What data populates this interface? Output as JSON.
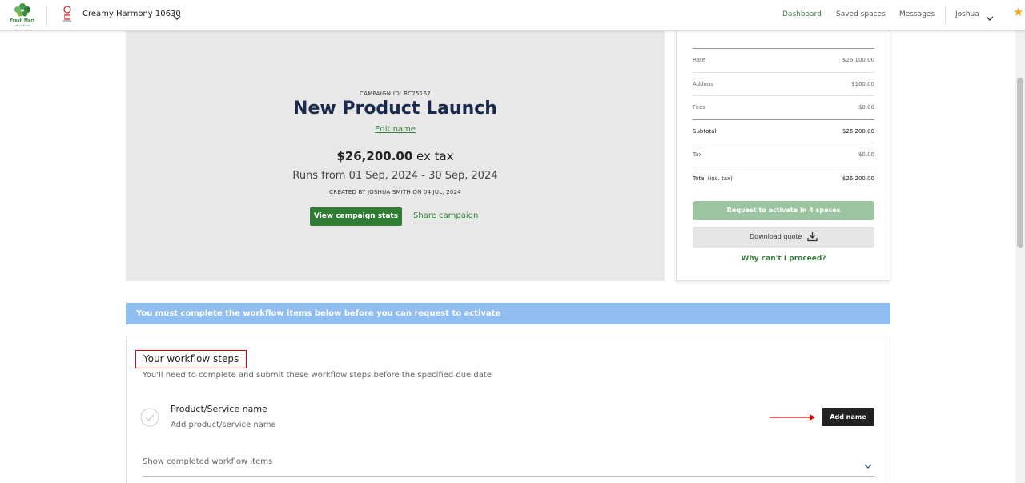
{
  "nav": {
    "logo_text": "Fresh Mart",
    "logo_sub": "Whole Foods",
    "store_name": "Creamy Harmony 10630",
    "links": {
      "dashboard": "Dashboard",
      "saved_spaces": "Saved spaces",
      "messages": "Messages"
    },
    "user": "Joshua",
    "icons": [
      "logo-icon",
      "store-icon",
      "chevron-down-icon",
      "star-icon"
    ]
  },
  "campaign": {
    "id_text": "CAMPAIGN ID: BC25167",
    "title": "New Product Launch",
    "edit_label": "Edit name",
    "price": "$26,200.00",
    "price_suffix": " ex tax",
    "runs": "Runs from 01 Sep, 2024 - 30 Sep, 2024",
    "created": "CREATED BY JOSHUA SMITH ON 04 JUL, 2024",
    "stats_button": "View campaign stats",
    "share_link": "Share campaign"
  },
  "pricing": {
    "rows": [
      {
        "label": "Rate",
        "value": "$26,100.00"
      },
      {
        "label": "Addons",
        "value": "$100.00"
      },
      {
        "label": "Fees",
        "value": "$0.00"
      },
      {
        "label": "Subtotal",
        "value": "$26,200.00"
      },
      {
        "label": "Tax",
        "value": "$0.00"
      },
      {
        "label": "Total (inc. tax)",
        "value": "$26,200.00"
      }
    ],
    "activate_button": "Request to activate in 4 spaces",
    "download_button": "Download quote",
    "why_link": "Why can't I proceed?"
  },
  "banner": {
    "text": "You must complete the workflow items below before you can request to activate"
  },
  "workflow": {
    "title": "Your workflow steps",
    "subtitle": "You'll need to complete and submit these workflow steps before the specified due date",
    "step": {
      "title": "Product/Service name",
      "desc": "Add product/service name",
      "button": "Add name"
    },
    "show_completed": "Show completed workflow items"
  },
  "colors": {
    "brand_green": "#2e7d32",
    "title_navy": "#1a2a4f",
    "banner_blue": "#90bef0",
    "annotation_red": "#dd0000"
  }
}
